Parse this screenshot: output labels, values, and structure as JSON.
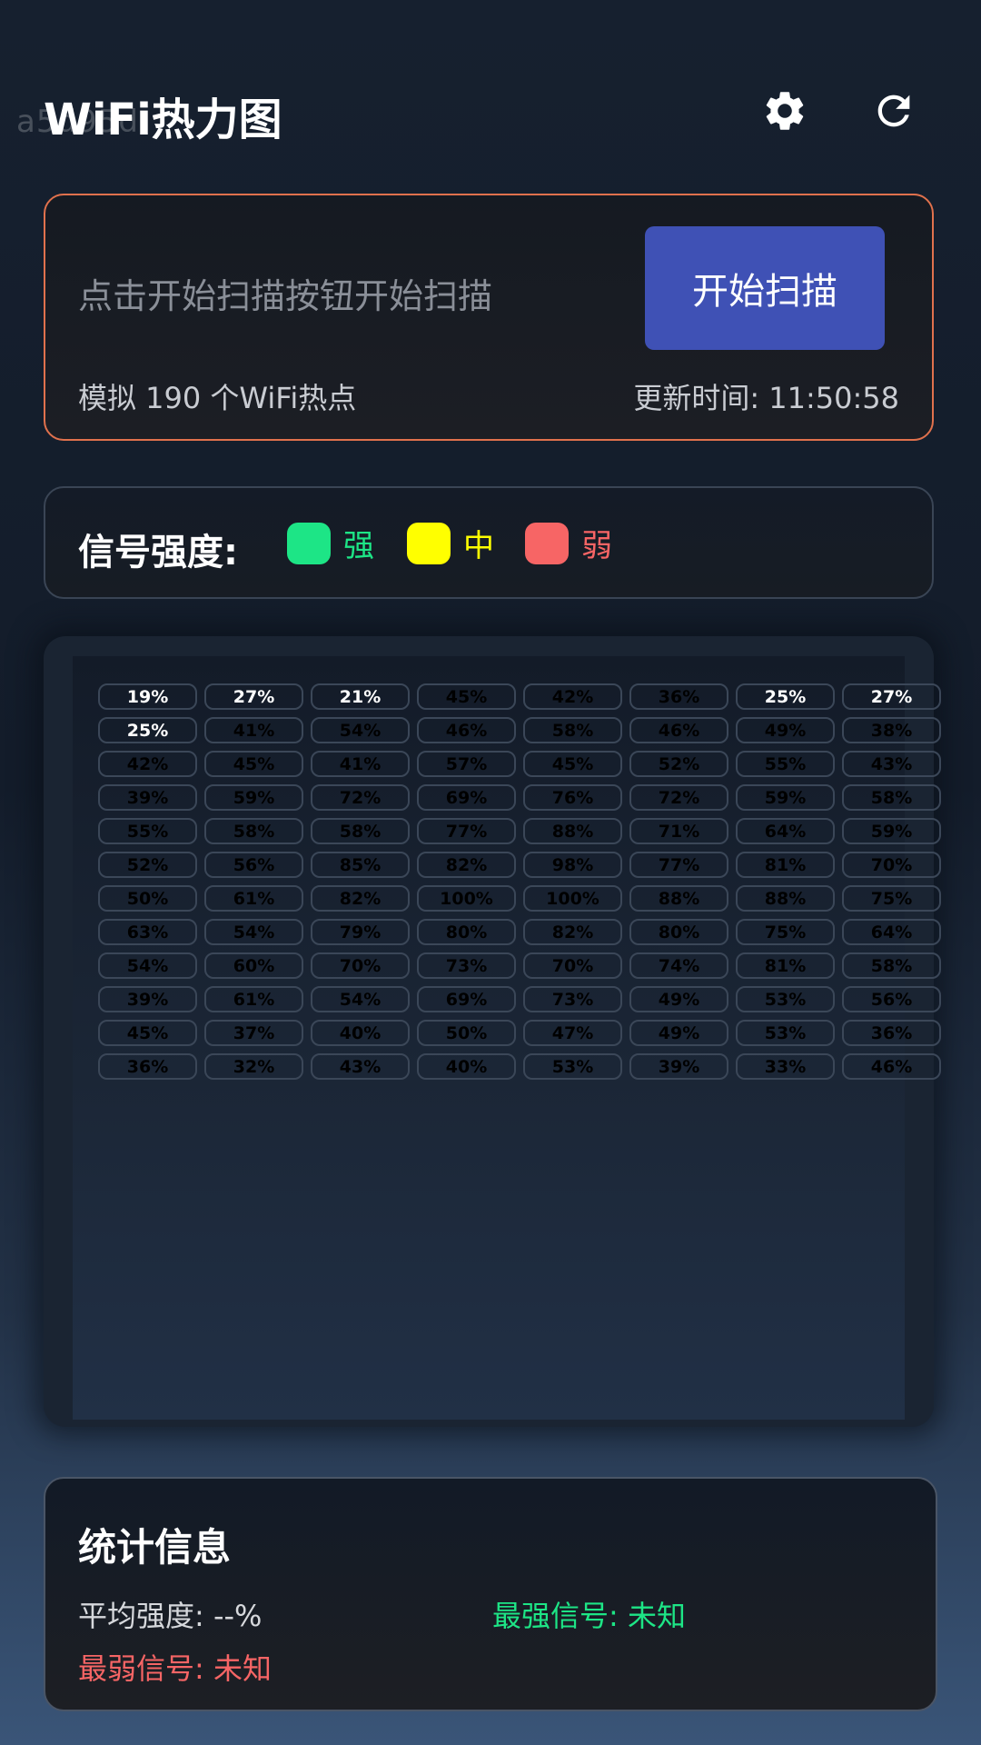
{
  "watermark": "a5d95d",
  "header": {
    "title": "WiFi热力图"
  },
  "scan": {
    "hint": "点击开始扫描按钮开始扫描",
    "button_label": "开始扫描",
    "count_text": "模拟 190 个WiFi热点",
    "time_text": "更新时间: 11:50:58"
  },
  "legend": {
    "title": "信号强度:",
    "items": [
      {
        "label": "强",
        "color": "#1de586"
      },
      {
        "label": "中",
        "color": "#ffff00"
      },
      {
        "label": "弱",
        "color": "#f76565"
      }
    ]
  },
  "heatmap": {
    "rows": [
      [
        "19%",
        "27%",
        "21%",
        "45%",
        "42%",
        "36%",
        "25%",
        "27%"
      ],
      [
        "25%",
        "41%",
        "54%",
        "46%",
        "58%",
        "46%",
        "49%",
        "38%"
      ],
      [
        "42%",
        "45%",
        "41%",
        "57%",
        "45%",
        "52%",
        "55%",
        "43%"
      ],
      [
        "39%",
        "59%",
        "72%",
        "69%",
        "76%",
        "72%",
        "59%",
        "58%"
      ],
      [
        "55%",
        "58%",
        "58%",
        "77%",
        "88%",
        "71%",
        "64%",
        "59%"
      ],
      [
        "52%",
        "56%",
        "85%",
        "82%",
        "98%",
        "77%",
        "81%",
        "70%"
      ],
      [
        "50%",
        "61%",
        "82%",
        "100%",
        "100%",
        "88%",
        "88%",
        "75%"
      ],
      [
        "63%",
        "54%",
        "79%",
        "80%",
        "82%",
        "80%",
        "75%",
        "64%"
      ],
      [
        "54%",
        "60%",
        "70%",
        "73%",
        "70%",
        "74%",
        "81%",
        "58%"
      ],
      [
        "39%",
        "61%",
        "54%",
        "69%",
        "73%",
        "49%",
        "53%",
        "56%"
      ],
      [
        "45%",
        "37%",
        "40%",
        "50%",
        "47%",
        "49%",
        "53%",
        "36%"
      ],
      [
        "36%",
        "32%",
        "43%",
        "40%",
        "53%",
        "39%",
        "33%",
        "46%"
      ]
    ],
    "lit_cells": [
      [
        0,
        0
      ],
      [
        0,
        1
      ],
      [
        0,
        2
      ],
      [
        0,
        6
      ],
      [
        0,
        7
      ],
      [
        1,
        0
      ]
    ]
  },
  "stats": {
    "title": "统计信息",
    "average": "平均强度: --%",
    "strongest": "最强信号: 未知",
    "weakest": "最弱信号: 未知"
  },
  "colors": {
    "accent": "#3f51b5",
    "scan_border": "#e0714d",
    "strong": "#1de586",
    "medium": "#ffff00",
    "weak": "#f76565"
  }
}
